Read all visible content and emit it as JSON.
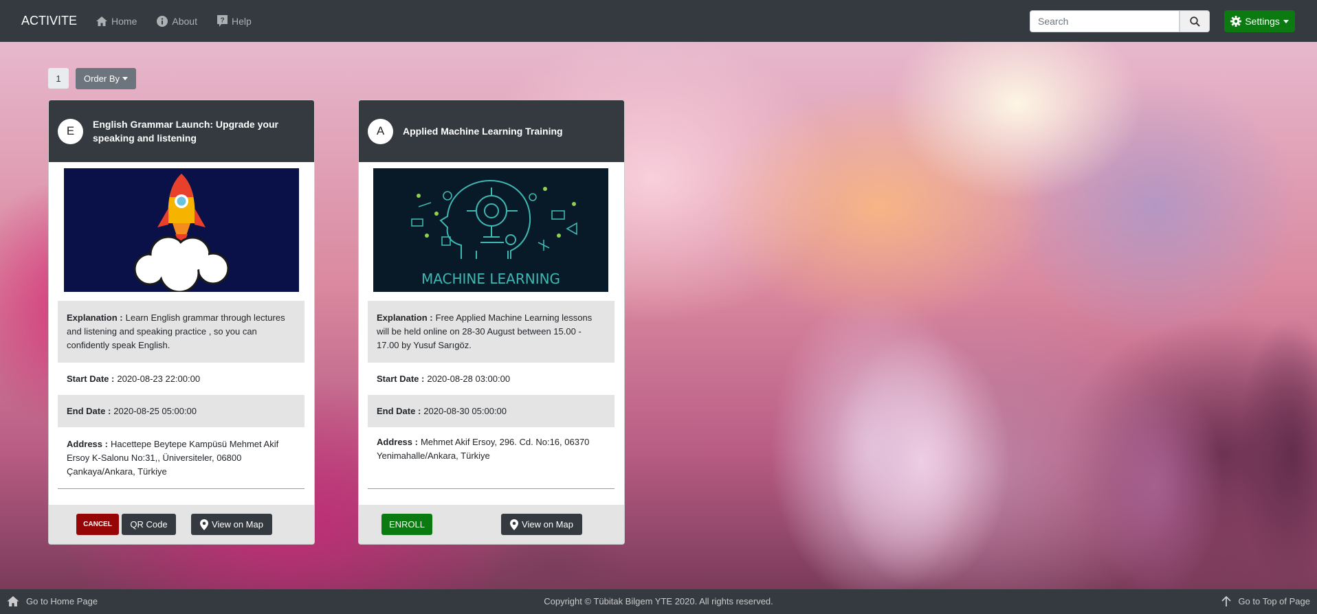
{
  "navbar": {
    "brand": "ACTIVITE",
    "links": [
      {
        "label": "Home",
        "icon": "home-icon"
      },
      {
        "label": "About",
        "icon": "info-icon"
      },
      {
        "label": "Help",
        "icon": "question-icon"
      }
    ],
    "search_placeholder": "Search",
    "settings_label": "Settings"
  },
  "controls": {
    "page_number": "1",
    "order_by_label": "Order By"
  },
  "cards": [
    {
      "avatar": "E",
      "title": "English Grammar Launch: Upgrade your speaking and listening",
      "explanation_label": "Explanation :",
      "explanation": "Learn English grammar through lectures and listening and speaking practice , so you can confidently speak English.",
      "start_label": "Start Date :",
      "start": "2020-08-23 22:00:00",
      "end_label": "End Date :",
      "end": "2020-08-25 05:00:00",
      "address_label": "Address :",
      "address": "Hacettepe Beytepe Kampüsü Mehmet Akif Ersoy K-Salonu No:31,, Üniversiteler, 06800 Çankaya/Ankara, Türkiye",
      "cancel_label": "CANCEL",
      "qr_label": "QR Code",
      "map_label": "View on Map"
    },
    {
      "avatar": "A",
      "title": "Applied Machine Learning Training",
      "image_text": "MACHINE LEARNING",
      "explanation_label": "Explanation :",
      "explanation": "Free Applied Machine Learning lessons will be held online on 28-30 August between 15.00 - 17.00 by Yusuf Sarıgöz.",
      "start_label": "Start Date :",
      "start": "2020-08-28 03:00:00",
      "end_label": "End Date :",
      "end": "2020-08-30 05:00:00",
      "address_label": "Address :",
      "address": "Mehmet Akif Ersoy, 296. Cd. No:16, 06370 Yenimahalle/Ankara, Türkiye",
      "enroll_label": "ENROLL",
      "map_label": "View on Map"
    }
  ],
  "footer": {
    "home_label": "Go to Home Page",
    "copyright": "Copyright © Tübitak Bilgem YTE 2020. All rights reserved.",
    "top_label": "Go to Top of Page"
  },
  "colors": {
    "navbar": "#343a40",
    "settings": "#0b7a11",
    "cancel": "#970606",
    "enroll": "#0b7a11",
    "order_by": "#6c757d"
  }
}
